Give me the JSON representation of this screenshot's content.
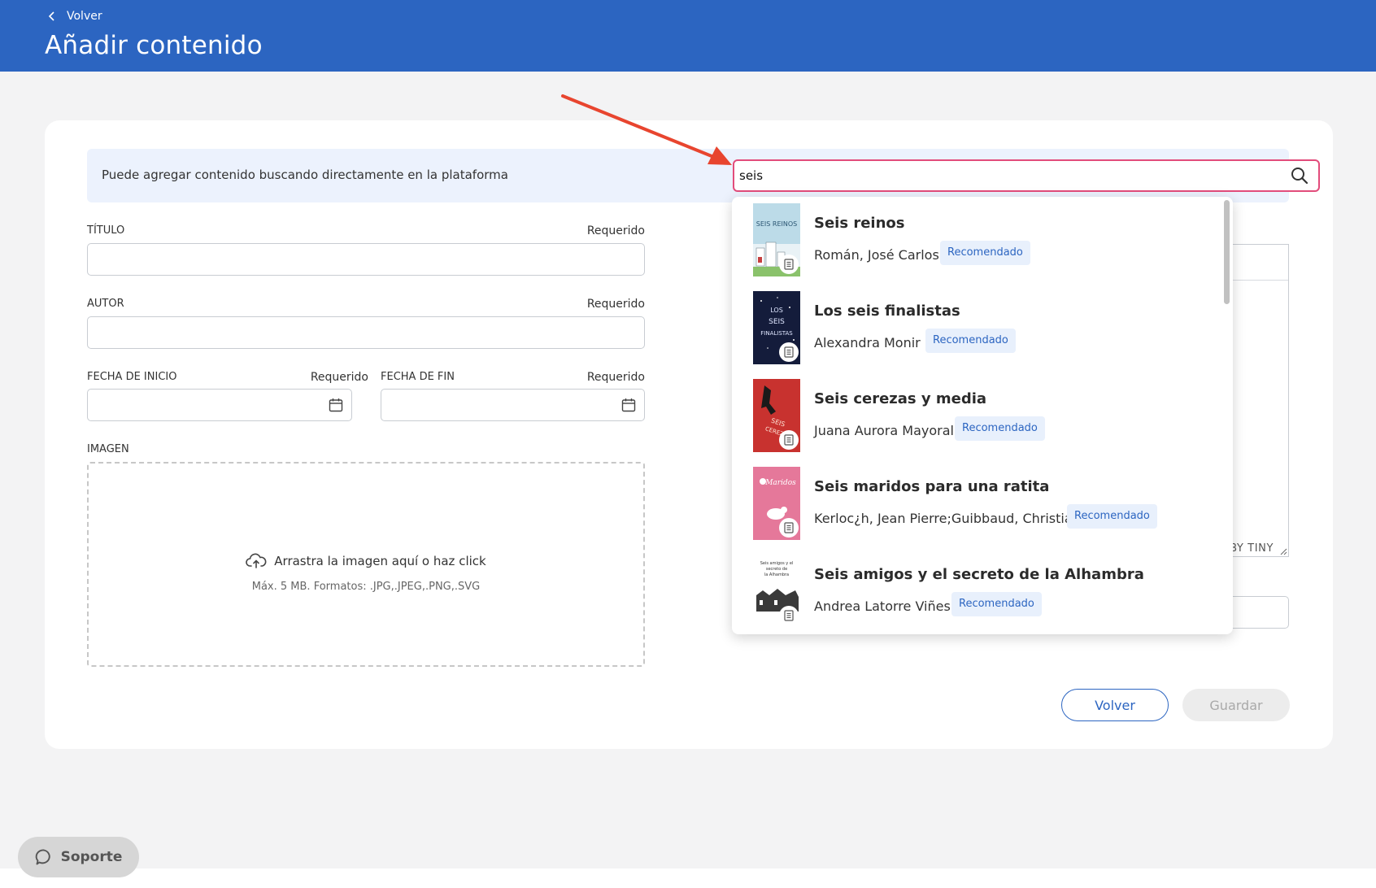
{
  "header": {
    "back_label": "Volver",
    "title": "Añadir contenido",
    "color": "#2c65c1"
  },
  "search": {
    "info_text": "Puede agregar contenido buscando directamente en la plataforma",
    "value": "seis",
    "border_color": "#e24c7b"
  },
  "form": {
    "title_label": "TÍTULO",
    "author_label": "AUTOR",
    "start_label": "FECHA DE INICIO",
    "end_label": "FECHA DE FIN",
    "image_label": "IMAGEN",
    "required": "Requerido",
    "dropzone_text": "Arrastra la imagen aquí o haz click",
    "dropzone_hint": "Máx. 5 MB. Formatos: .JPG,.JPEG,.PNG,.SVG",
    "editor_powered": "BY TINY"
  },
  "buttons": {
    "back": "Volver",
    "save": "Guardar"
  },
  "results": [
    {
      "title": "Seis reinos",
      "author": "Román, José Carlos",
      "tag": "Recomendado"
    },
    {
      "title": "Los seis finalistas",
      "author": "Alexandra Monir",
      "tag": "Recomendado"
    },
    {
      "title": "Seis cerezas y media",
      "author": "Juana Aurora Mayoral",
      "tag": "Recomendado"
    },
    {
      "title": "Seis maridos para una ratita",
      "author": "Kerloc¿h, Jean Pierre;Guibbaud, Christian",
      "tag": "Recomendado"
    },
    {
      "title": "Seis amigos y el secreto de la Alhambra",
      "author": "Andrea Latorre Viñes",
      "tag": "Recomendado"
    }
  ],
  "support": {
    "label": "Soporte"
  }
}
